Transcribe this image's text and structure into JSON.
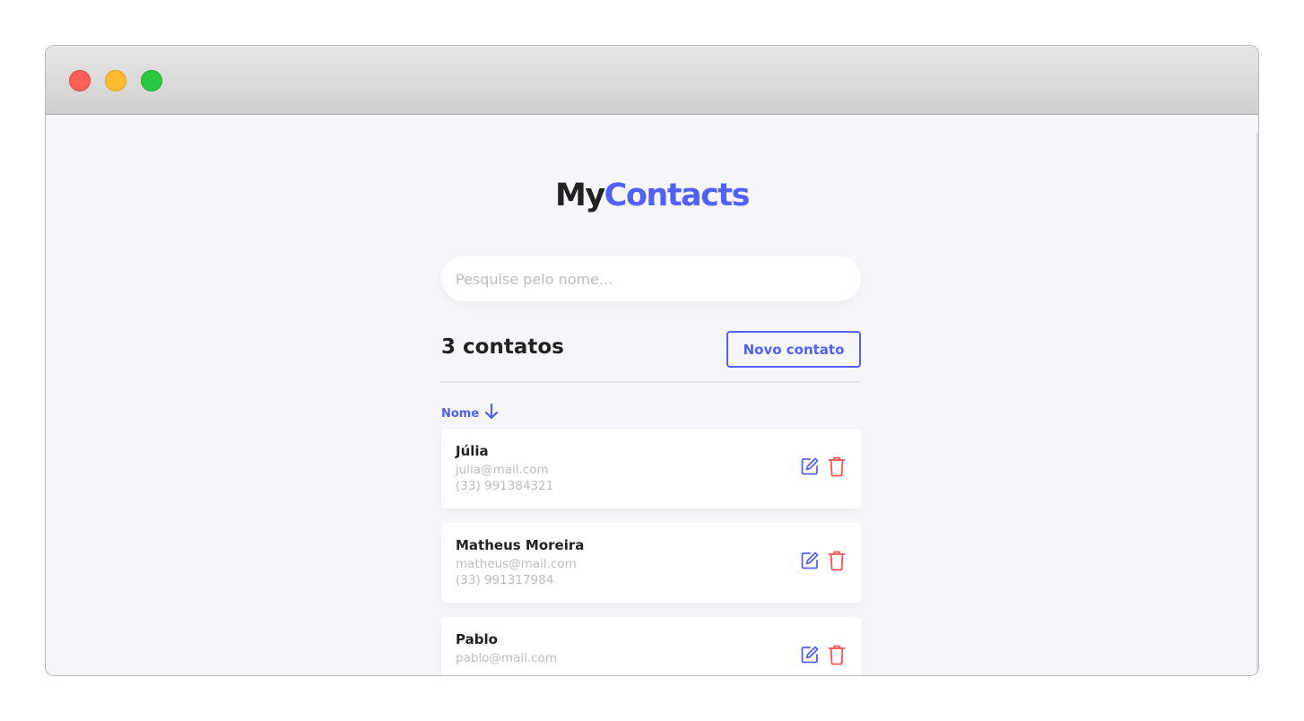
{
  "app": {
    "logo_part1": "My",
    "logo_part2": "Contacts",
    "accent_color": "#5061fc",
    "danger_color": "#fc5050"
  },
  "search": {
    "placeholder": "Pesquise pelo nome...",
    "value": ""
  },
  "list_header": {
    "count_label": "3 contatos",
    "new_button_label": "Novo contato"
  },
  "sort": {
    "label": "Nome",
    "direction_icon": "arrow-down-icon"
  },
  "contacts": [
    {
      "name": "Júlia",
      "email": "julia@mail.com",
      "phone": "(33) 991384321"
    },
    {
      "name": "Matheus Moreira",
      "email": "matheus@mail.com",
      "phone": "(33) 991317984"
    },
    {
      "name": "Pablo",
      "email": "pablo@mail.com",
      "phone": ""
    }
  ],
  "icons": {
    "edit": "edit-icon",
    "delete": "trash-icon"
  }
}
